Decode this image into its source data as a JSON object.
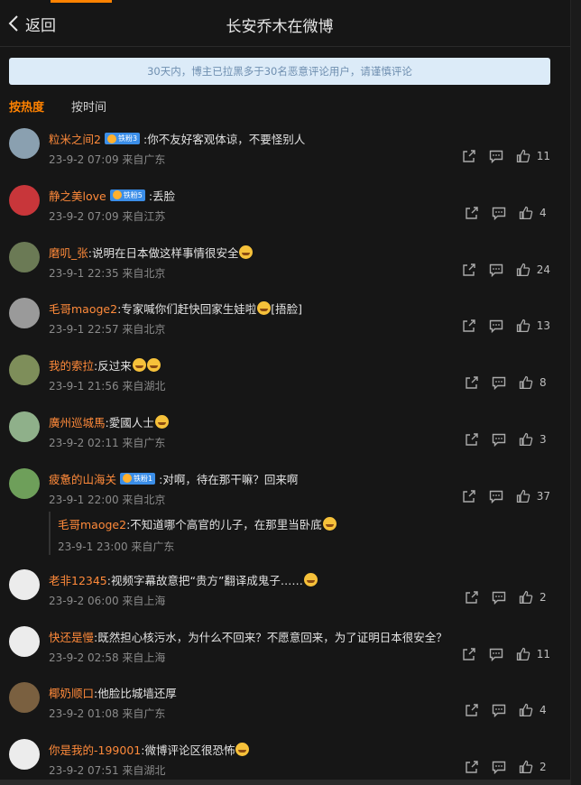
{
  "nav": {
    "back_label": "返回",
    "title": "长安乔木在微博"
  },
  "notice": "30天内，博主已拉黑多于30名恶意评论用户，请谨慎评论",
  "sort": {
    "hot": "按热度",
    "time": "按时间"
  },
  "comments": [
    {
      "name": "粒米之间2",
      "badge": "铁粉3",
      "text": ":你不友好客观体谅，不要怪别人",
      "meta": "23-9-2 07:09 来自广东",
      "likes": "11",
      "avatar_color": "#8aa0b0"
    },
    {
      "name": "静之美love",
      "badge": "铁粉5",
      "text": ":丢脸",
      "meta": "23-9-2 07:09 来自江苏",
      "likes": "4",
      "avatar_color": "#c8363a"
    },
    {
      "name": "磨叽_张",
      "badge": "",
      "text": ":说明在日本做这样事情很安全",
      "emoji": true,
      "meta": "23-9-1 22:35 来自北京",
      "likes": "24",
      "avatar_color": "#6b7a55"
    },
    {
      "name": "毛哥maoge2",
      "badge": "",
      "text": ":专家喊你们赶快回家生娃啦",
      "emoji": true,
      "text_tail": "[捂脸]",
      "meta": "23-9-1 22:57 来自北京",
      "likes": "13",
      "avatar_color": "#9a9a9a"
    },
    {
      "name": "我的索拉",
      "badge": "",
      "text": ":反过来",
      "emoji2": true,
      "meta": "23-9-1 21:56 来自湖北",
      "likes": "8",
      "avatar_color": "#7e8e5a"
    },
    {
      "name": "廣州巡城馬",
      "badge": "",
      "text": ":愛國人士",
      "emoji": true,
      "meta": "23-9-2 02:11 来自广东",
      "likes": "3",
      "avatar_color": "#8fb08a"
    },
    {
      "name": "疲惫的山海关",
      "badge": "铁粉1",
      "text": ":对啊，待在那干嘛？回来啊",
      "meta": "23-9-1 22:00 来自北京",
      "likes": "37",
      "avatar_color": "#6e9f5a",
      "reply": {
        "name": "毛哥maoge2",
        "text": ":不知道哪个高官的儿子，在那里当卧底",
        "meta": "23-9-1 23:00 来自广东"
      }
    },
    {
      "name": "老非12345",
      "badge": "",
      "text": ":视频字幕故意把“贵方”翻译成鬼子……",
      "emoji": true,
      "meta": "23-9-2 06:00 来自上海",
      "likes": "2",
      "avatar_color": "#ececec"
    },
    {
      "name": "快还是慢",
      "badge": "",
      "text": ":既然担心核污水，为什么不回来？不愿意回来，为了证明日本很安全？",
      "meta": "23-9-2 02:58 来自上海",
      "likes": "11",
      "avatar_color": "#ececec"
    },
    {
      "name": "椰奶顺口",
      "badge": "",
      "text": ":他脸比城墙还厚",
      "meta": "23-9-2 01:08 来自广东",
      "likes": "4",
      "avatar_color": "#7a6040"
    },
    {
      "name": "你是我的-199001",
      "badge": "",
      "text": ":微博评论区很恐怖",
      "emoji": true,
      "meta": "23-9-2 07:51 来自湖北",
      "likes": "2",
      "avatar_color": "#ececec"
    }
  ],
  "colors": {
    "accent": "#ff8200",
    "username": "#ff8a3a",
    "background": "#161616"
  }
}
